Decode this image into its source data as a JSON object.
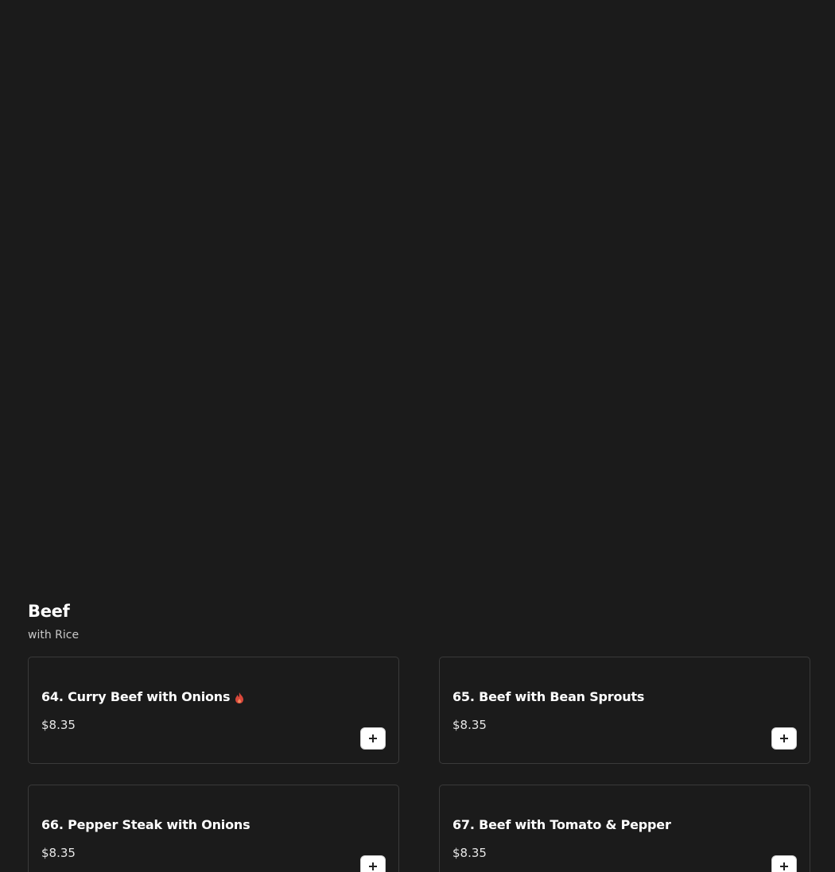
{
  "section": {
    "title": "Beef",
    "subtitle": "with Rice"
  },
  "items": [
    {
      "name": "64. Curry Beef with Onions",
      "price": "$8.35",
      "spicy": true
    },
    {
      "name": "65. Beef with Bean Sprouts",
      "price": "$8.35",
      "spicy": false
    },
    {
      "name": "66. Pepper Steak with Onions",
      "price": "$8.35",
      "spicy": false
    },
    {
      "name": "67. Beef with Tomato & Pepper",
      "price": "$8.35",
      "spicy": false
    }
  ],
  "colors": {
    "background": "#1b1b1b",
    "card_border": "#3a3a3a",
    "spicy": "#d9473a",
    "add_button": "#ffffff"
  },
  "icons": {
    "spicy": "flame-icon",
    "add": "plus-icon"
  }
}
